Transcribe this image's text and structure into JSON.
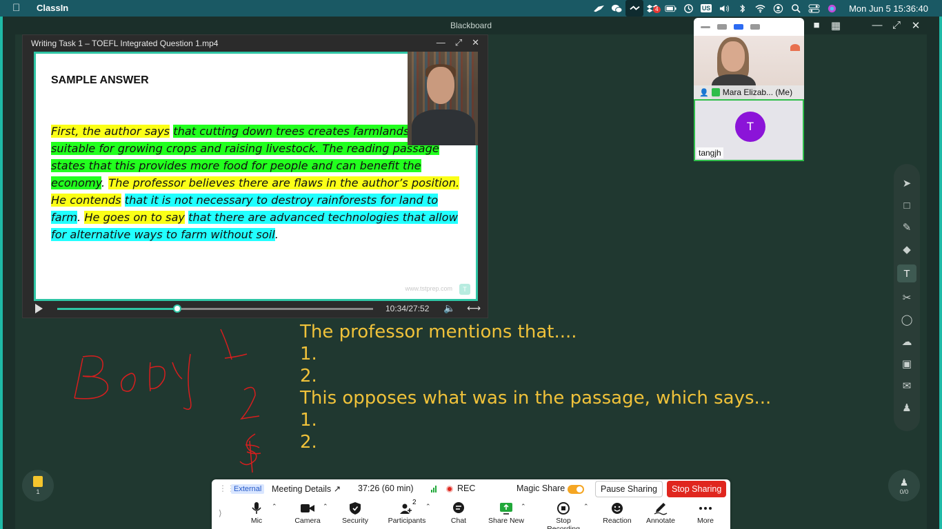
{
  "menubar": {
    "app_name": "ClassIn",
    "wechat_badge": "4",
    "input_source": "US",
    "clock": "Mon Jun 5  15:36:40"
  },
  "board": {
    "title": "Blackboard",
    "lines": [
      "The professor mentions that....",
      "1.",
      "2.",
      "This opposes what was in the passage, which says...",
      "1.",
      "2."
    ]
  },
  "video": {
    "title": "Writing Task 1 – TOEFL Integrated Question 1.mp4",
    "heading": "SAMPLE ANSWER",
    "segments": [
      {
        "text": "First, the author says",
        "style": "hl-y"
      },
      {
        "text": " ",
        "style": ""
      },
      {
        "text": "that cutting down trees creates farmlands now suitable for growing crops and raising livestock. The reading passage states that this provides more food for people and can benefit the economy",
        "style": "hl-g"
      },
      {
        "text": ". ",
        "style": ""
      },
      {
        "text": "The professor believes there are flaws in the author’s position. He contends",
        "style": "hl-y"
      },
      {
        "text": " ",
        "style": ""
      },
      {
        "text": "that it is not necessary to destroy rainforests for land to farm",
        "style": "hl-c"
      },
      {
        "text": ". ",
        "style": ""
      },
      {
        "text": "He goes on to say",
        "style": "hl-y"
      },
      {
        "text": " ",
        "style": ""
      },
      {
        "text": "that there are advanced technologies that allow for alternative ways to farm without soil",
        "style": "hl-c"
      },
      {
        "text": ".",
        "style": ""
      }
    ],
    "watermark": "www.tstprep.com",
    "time": "10:34/27:52",
    "progress_fraction": 0.38
  },
  "participants": {
    "me_label": "Mara Elizab... (Me)",
    "other_initial": "T",
    "other_name": "tangjh"
  },
  "left_file_count": "1",
  "right_user_count": "0/0",
  "zoom": {
    "external": "External",
    "meeting_details": "Meeting Details",
    "timer": "37:26  (60 min)",
    "rec": "REC",
    "magic_share": "Magic Share",
    "pause_sharing": "Pause Sharing",
    "stop_sharing": "Stop Sharing",
    "participants_count": "2",
    "items": {
      "mic": "Mic",
      "camera": "Camera",
      "security": "Security",
      "participants": "Participants",
      "chat": "Chat",
      "share_new": "Share New",
      "stop_recording": "Stop Recording",
      "reaction": "Reaction",
      "annotate": "Annotate",
      "more": "More"
    }
  },
  "colors": {
    "menubar": "#1a5964",
    "board": "#203830",
    "chalk_yellow": "#f0c23a",
    "ink_red": "#d91e1e",
    "stop_red": "#e0261e",
    "active_green": "#2fbd4a"
  }
}
